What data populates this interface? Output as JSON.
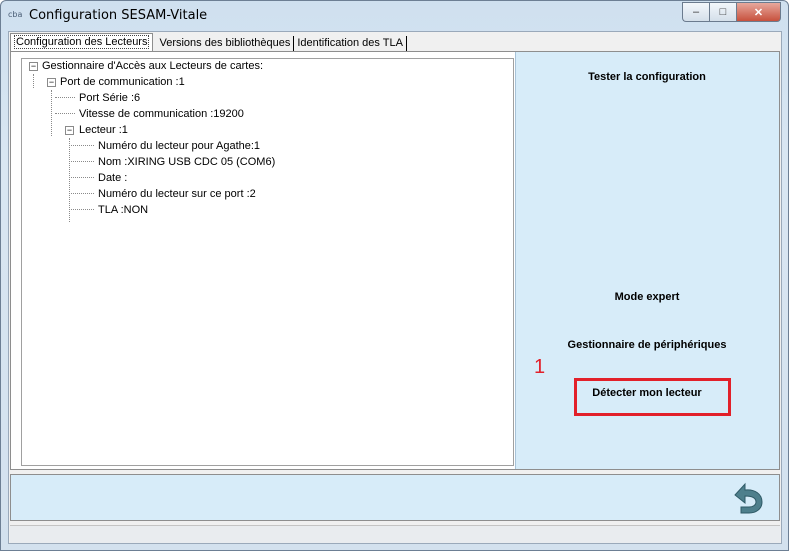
{
  "window": {
    "icon_text": "cba",
    "title": "Configuration SESAM-Vitale",
    "controls": {
      "minimize": "–",
      "maximize": "□",
      "close": "✕"
    }
  },
  "tabs": [
    {
      "label": "Configuration des Lecteurs",
      "active": true
    },
    {
      "label": "Versions des bibliothèques",
      "active": false
    },
    {
      "label": "Identification des TLA",
      "active": false
    }
  ],
  "tree": {
    "root": "Gestionnaire d'Accès aux Lecteurs de cartes:",
    "port": "Port de communication :1",
    "port_serie": "Port Série :6",
    "vitesse": "Vitesse de communication :19200",
    "lecteur": "Lecteur :1",
    "numero_agathe": "Numéro du lecteur pour Agathe:1",
    "nom": "Nom :XIRING USB CDC 05 (COM6)",
    "date": "Date :",
    "numero_port": "Numéro du lecteur sur ce port :2",
    "tla": "TLA :NON",
    "expander_symbol": "−"
  },
  "side": {
    "tester": "Tester la configuration",
    "expert": "Mode expert",
    "peripheriques": "Gestionnaire de périphériques",
    "detecter": "Détecter mon lecteur",
    "marker": "1"
  },
  "colors": {
    "highlight": "#e2202a",
    "panel": "#d7ecf9",
    "back_arrow": "#4e7f8c"
  },
  "icons": {
    "back": "back-arrow-icon"
  }
}
